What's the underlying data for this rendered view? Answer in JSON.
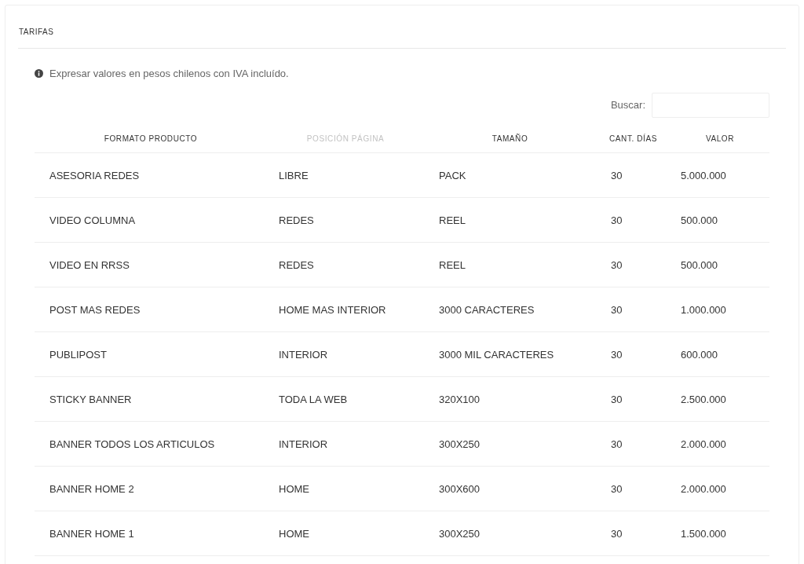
{
  "panel": {
    "title": "TARIFAS"
  },
  "notice": "Expresar valores en pesos chilenos con IVA incluído.",
  "search": {
    "label": "Buscar:"
  },
  "table": {
    "columns": [
      {
        "label": "FORMATO PRODUCTO",
        "sorted": false
      },
      {
        "label": "POSICIÓN PÁGINA",
        "sorted": true
      },
      {
        "label": "TAMAÑO",
        "sorted": false
      },
      {
        "label": "CANT. DÍAS",
        "sorted": false
      },
      {
        "label": "VALOR",
        "sorted": false
      }
    ],
    "rows": [
      [
        "ASESORIA REDES",
        "LIBRE",
        "PACK",
        "30",
        "5.000.000"
      ],
      [
        "VIDEO COLUMNA",
        "REDES",
        "REEL",
        "30",
        "500.000"
      ],
      [
        "VIDEO EN RRSS",
        "REDES",
        "REEL",
        "30",
        "500.000"
      ],
      [
        "POST MAS REDES",
        "HOME MAS INTERIOR",
        "3000 CARACTERES",
        "30",
        "1.000.000"
      ],
      [
        "PUBLIPOST",
        "INTERIOR",
        "3000 MIL CARACTERES",
        "30",
        "600.000"
      ],
      [
        "STICKY BANNER",
        "TODA LA WEB",
        "320X100",
        "30",
        "2.500.000"
      ],
      [
        "BANNER TODOS LOS ARTICULOS",
        "INTERIOR",
        "300X250",
        "30",
        "2.000.000"
      ],
      [
        "BANNER HOME 2",
        "HOME",
        "300X600",
        "30",
        "2.000.000"
      ],
      [
        "BANNER HOME 1",
        "HOME",
        "300X250",
        "30",
        "1.500.000"
      ]
    ]
  }
}
